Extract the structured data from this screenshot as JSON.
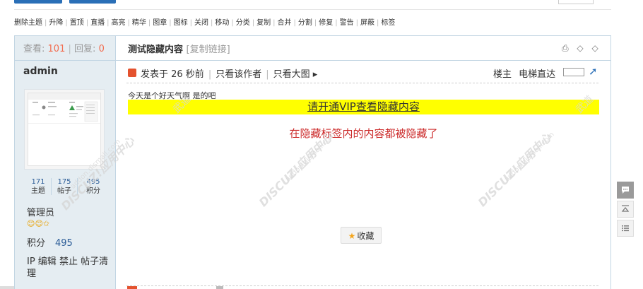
{
  "modbar": [
    "删除主题",
    "升降",
    "置顶",
    "直播",
    "高亮",
    "精华",
    "图章",
    "图标",
    "关闭",
    "移动",
    "分类",
    "复制",
    "合并",
    "分割",
    "修复",
    "警告",
    "屏蔽",
    "标签"
  ],
  "thread": {
    "views_label": "查看:",
    "views": "101",
    "sep": "|",
    "replies_label": "回复:",
    "replies": "0",
    "title": "测试隐藏内容",
    "copy_link": "[复制链接]",
    "tools": "⎙ ◇ ◇"
  },
  "author": {
    "name": "admin",
    "stats": [
      {
        "num": "171",
        "label": "主题"
      },
      {
        "num": "175",
        "label": "帖子"
      },
      {
        "num": "495",
        "label": "积分"
      }
    ],
    "group": "管理员",
    "medals": "😊😊✩",
    "credit_label": "积分",
    "credit_value": "495",
    "admin_links": "IP 编辑 禁止 帖子清理"
  },
  "post": {
    "posted": "发表于 26 秒前",
    "only_author": "只看该作者",
    "big_image": "只看大图 ▸",
    "floor": "楼主",
    "elevator": "电梯直达",
    "message": "今天是个好天气啊 是的吧",
    "vip_link": "请开通VIP查看隐藏内容",
    "hidden_note": "在隐藏标签内的内容都被隐藏了",
    "favorite": "收藏"
  },
  "watermark": {
    "brand": "DISCUZ!应用中心",
    "site": "addon.dismall.com",
    "tag": "武道"
  },
  "colors": {
    "accent": "#2a6fb7",
    "side_bg": "#e5edf2",
    "highlight": "#ffff00",
    "hidden_text": "#cc2a2a",
    "stat_num": "#f26c4f"
  }
}
